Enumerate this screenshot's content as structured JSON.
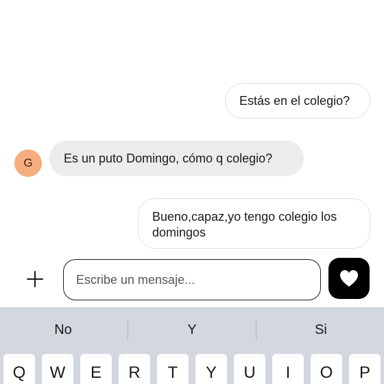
{
  "messages": [
    {
      "id": "msg1",
      "direction": "outgoing",
      "text": "Estás en el colegio?"
    },
    {
      "id": "msg2",
      "direction": "incoming",
      "text": "Es un puto Domingo, cómo q colegio?"
    },
    {
      "id": "msg3",
      "direction": "outgoing",
      "text": "Bueno,capaz,yo tengo colegio los domingos"
    }
  ],
  "avatar": {
    "initial": "G",
    "color": "#f6ad7f"
  },
  "composer": {
    "plus_icon": "plus-icon",
    "placeholder": "Escribe un mensaje...",
    "send_icon": "heart-icon"
  },
  "keyboard": {
    "suggestions": [
      "No",
      "Y",
      "Si"
    ],
    "keys": [
      "Q",
      "W",
      "E",
      "R",
      "T",
      "Y",
      "U",
      "I",
      "O",
      "P"
    ]
  },
  "colors": {
    "incoming_bubble": "#ececec",
    "outgoing_border": "#e3e3e3",
    "keyboard_bg": "#d3d7de",
    "send_button": "#000000"
  }
}
